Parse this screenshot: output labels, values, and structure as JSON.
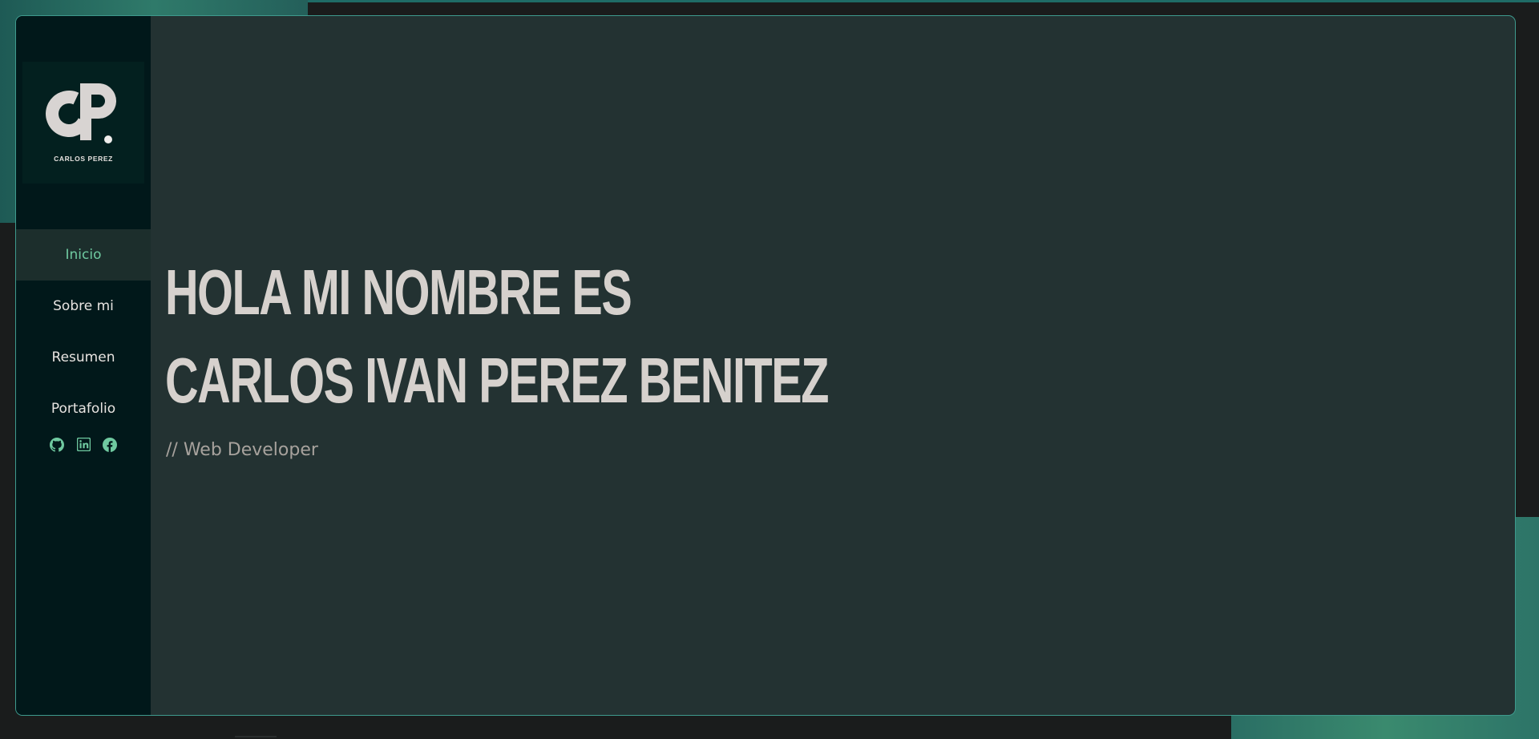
{
  "logo": {
    "text": "CARLOS PEREZ"
  },
  "nav": {
    "items": [
      {
        "label": "Inicio",
        "active": true
      },
      {
        "label": "Sobre mi",
        "active": false
      },
      {
        "label": "Resumen",
        "active": false
      },
      {
        "label": "Portafolio",
        "active": false
      }
    ]
  },
  "social": {
    "icons": [
      "github-icon",
      "linkedin-icon",
      "facebook-icon"
    ],
    "color": "#6fc9a0"
  },
  "hero": {
    "line1": "HOLA MI NOMBRE ES",
    "line2": "CARLOS IVAN PEREZ BENITEZ",
    "subtitle": "// Web Developer"
  },
  "colors": {
    "accent": "#6fc9a0",
    "frame_border": "#3e9a8d",
    "sidebar_bg": "#01181a",
    "main_bg": "#233232",
    "heading": "#d6d1cd"
  }
}
